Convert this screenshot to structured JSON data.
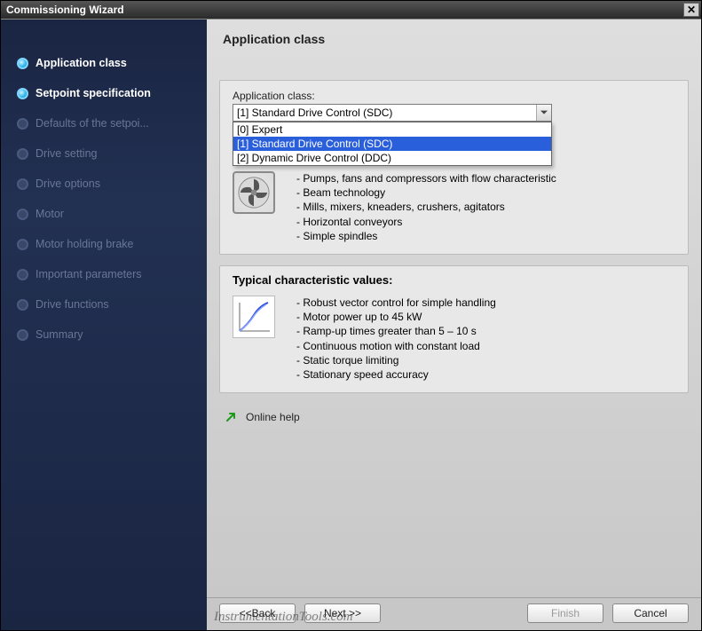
{
  "window": {
    "title": "Commissioning Wizard"
  },
  "sidebar": {
    "steps": [
      {
        "label": "Application class"
      },
      {
        "label": "Setpoint specification"
      },
      {
        "label": "Defaults of the setpoi..."
      },
      {
        "label": "Drive setting"
      },
      {
        "label": "Drive options"
      },
      {
        "label": "Motor"
      },
      {
        "label": "Motor holding brake"
      },
      {
        "label": "Important parameters"
      },
      {
        "label": "Drive functions"
      },
      {
        "label": "Summary"
      }
    ]
  },
  "header": {
    "title": "Application class"
  },
  "panel1": {
    "field_label": "Application class:",
    "combo_value": "[1] Standard Drive Control (SDC)",
    "options": {
      "0": "[0] Expert",
      "1": "[1] Standard Drive Control (SDC)",
      "2": "[2] Dynamic Drive Control (DDC)"
    },
    "desc": {
      "0": "Pumps, fans and compressors with flow characteristic",
      "1": "Beam technology",
      "2": "Mills, mixers, kneaders, crushers, agitators",
      "3": "Horizontal conveyors",
      "4": "Simple spindles"
    },
    "icon": "fan-icon"
  },
  "panel2": {
    "title": "Typical characteristic values:",
    "desc": {
      "0": "Robust vector control for simple handling",
      "1": "Motor power up to 45 kW",
      "2": "Ramp-up times greater than 5 – 10 s",
      "3": "Continuous motion with constant load",
      "4": "Static torque limiting",
      "5": "Stationary speed accuracy"
    },
    "icon": "chart-icon"
  },
  "help": {
    "label": "Online help",
    "icon": "arrow-up-right-icon"
  },
  "footer": {
    "back": "<<Back",
    "next": "Next >>",
    "finish": "Finish",
    "cancel": "Cancel"
  },
  "watermark": "InstrumentationTools.com",
  "colors": {
    "accent": "#2a5fdc",
    "sidebar": "#1e2a4a"
  }
}
